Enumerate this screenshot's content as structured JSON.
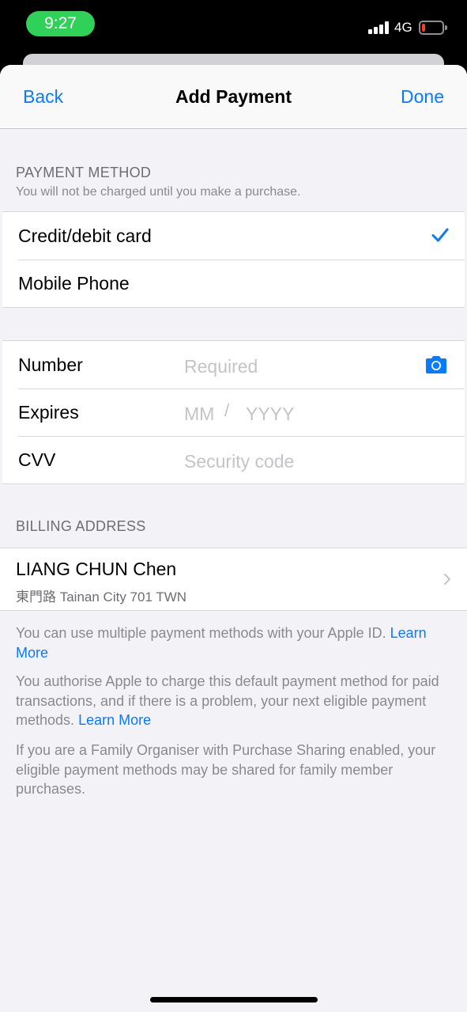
{
  "status_bar": {
    "time": "9:27",
    "network": "4G",
    "battery_level": 0.15,
    "colors": {
      "time_pill": "#30d158",
      "battery_low": "#ff3b30"
    }
  },
  "nav": {
    "back_label": "Back",
    "title": "Add Payment",
    "done_label": "Done"
  },
  "payment_method": {
    "header": "PAYMENT METHOD",
    "subtitle": "You will not be charged until you make a purchase.",
    "options": [
      {
        "label": "Credit/debit card",
        "selected": true,
        "icon": "checkmark-icon"
      },
      {
        "label": "Mobile Phone",
        "selected": false
      }
    ]
  },
  "card_form": {
    "number_label": "Number",
    "number_placeholder": "Required",
    "number_icon": "camera-icon",
    "expires_label": "Expires",
    "month_placeholder": "MM",
    "separator": "/",
    "year_placeholder": "YYYY",
    "cvv_label": "CVV",
    "cvv_placeholder": "Security code"
  },
  "billing": {
    "header": "BILLING ADDRESS",
    "name": "LIANG CHUN Chen",
    "address": "東門路 Tainan City 701 TWN",
    "icon": "chevron-right-icon"
  },
  "footer": {
    "p1": "You can use multiple payment methods with your Apple ID.",
    "p1_link": "Learn More",
    "p2": "You authorise Apple to charge this default payment method for paid transactions, and if there is a problem, your next eligible payment methods.",
    "p2_link": "Learn More",
    "p3": "If you are a Family Organiser with Purchase Sharing enabled, your eligible payment methods may be shared for family member purchases."
  },
  "colors": {
    "accent": "#0a7aff",
    "background": "#f2f2f7",
    "secondary_text": "#8a8a8e",
    "placeholder": "#c4c4c7"
  }
}
